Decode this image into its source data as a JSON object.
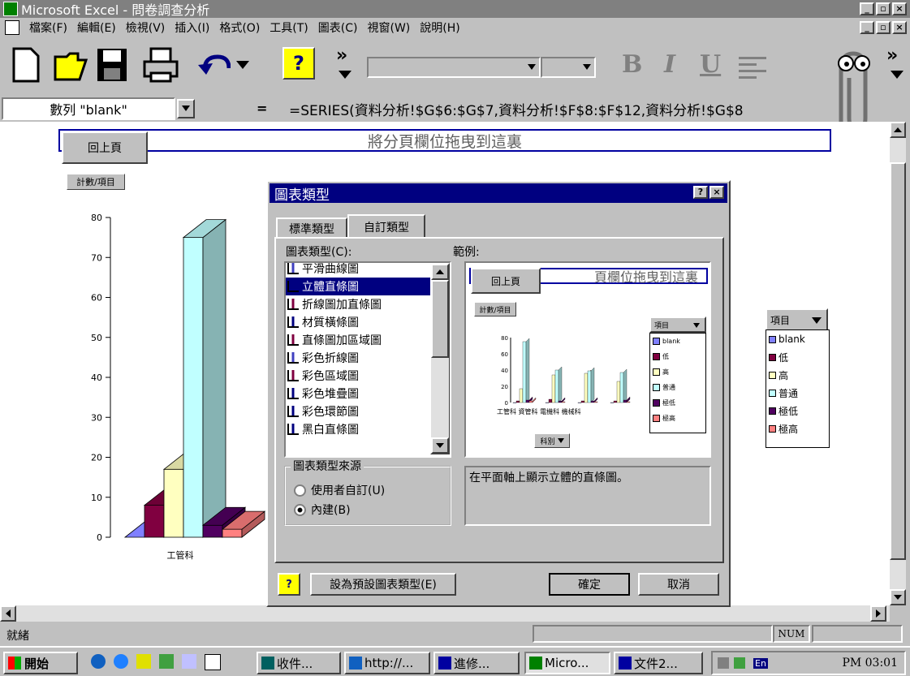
{
  "window": {
    "title": "Microsoft Excel - 問卷調查分析",
    "cap_min": "_",
    "cap_max": "▫",
    "cap_close": "×"
  },
  "menu": [
    "檔案(F)",
    "編輯(E)",
    "檢視(V)",
    "插入(I)",
    "格式(O)",
    "工具(T)",
    "圖表(C)",
    "視窗(W)",
    "說明(H)"
  ],
  "formula": {
    "name_box": "數列 \"blank\"",
    "equals": "=",
    "content": "=SERIES(資料分析!$G$6:$G$7,資料分析!$F$8:$F$12,資料分析!$G$8"
  },
  "sheet": {
    "back_button": "回上頁",
    "page_drop_zone": "將分頁欄位拖曳到這裏",
    "count_field": "計數/項目",
    "legend_header": "項目",
    "legend_items": [
      {
        "label": "blank",
        "color": "#8080ff"
      },
      {
        "label": "低",
        "color": "#800040"
      },
      {
        "label": "高",
        "color": "#ffffc0"
      },
      {
        "label": "普通",
        "color": "#c0ffff"
      },
      {
        "label": "極低",
        "color": "#500060"
      },
      {
        "label": "極高",
        "color": "#ff8080"
      }
    ]
  },
  "chart_data": {
    "type": "bar",
    "categories": [
      "工管科"
    ],
    "ylim": [
      0,
      80
    ],
    "yticks": [
      "80",
      "70",
      "60",
      "50",
      "40",
      "30",
      "20",
      "10",
      "0"
    ],
    "series": [
      {
        "name": "blank",
        "values": [
          0
        ],
        "color": "#8080ff"
      },
      {
        "name": "低",
        "values": [
          8
        ],
        "color": "#800040"
      },
      {
        "name": "高",
        "values": [
          17
        ],
        "color": "#ffffc0"
      },
      {
        "name": "普通",
        "values": [
          75
        ],
        "color": "#c0ffff"
      },
      {
        "name": "極低",
        "values": [
          3
        ],
        "color": "#500060"
      },
      {
        "name": "極高",
        "values": [
          2
        ],
        "color": "#ff8080"
      }
    ]
  },
  "dialog": {
    "title": "圖表類型",
    "help": "?",
    "close": "×",
    "tabs": [
      "標準類型",
      "自訂類型"
    ],
    "chart_type_label": "圖表類型(C):",
    "chart_types": [
      "平滑曲線圖",
      "立體直條圖",
      "折線圖加直條圖",
      "材質橫條圖",
      "直條圖加區域圖",
      "彩色折線圖",
      "彩色區域圖",
      "彩色堆疊圖",
      "彩色環節圖",
      "黑白直條圖"
    ],
    "selected_index": 1,
    "source_label": "圖表類型來源",
    "radio_user": "使用者自訂(U)",
    "radio_builtin": "內建(B)",
    "sample_label": "範例:",
    "sample_back": "回上頁",
    "sample_drop": "頁欄位拖曳到這裏",
    "sample_count": "計數/項目",
    "sample_yticks": [
      "80",
      "60",
      "40",
      "20",
      "0"
    ],
    "sample_categories": "工管科 資管科 電機科 機械科",
    "sample_filter": "科別",
    "sample_legend_header": "項目",
    "description": "在平面軸上顯示立體的直條圖。",
    "set_default": "設為預設圖表類型(E)",
    "ok": "確定",
    "cancel": "取消"
  },
  "status": {
    "ready": "就緒",
    "num": "NUM"
  },
  "taskbar": {
    "start": "開始",
    "tasks": [
      "收件...",
      "http://...",
      "進修...",
      "Micro...",
      "文件2..."
    ],
    "ime": "En",
    "clock": "PM 03:01"
  }
}
